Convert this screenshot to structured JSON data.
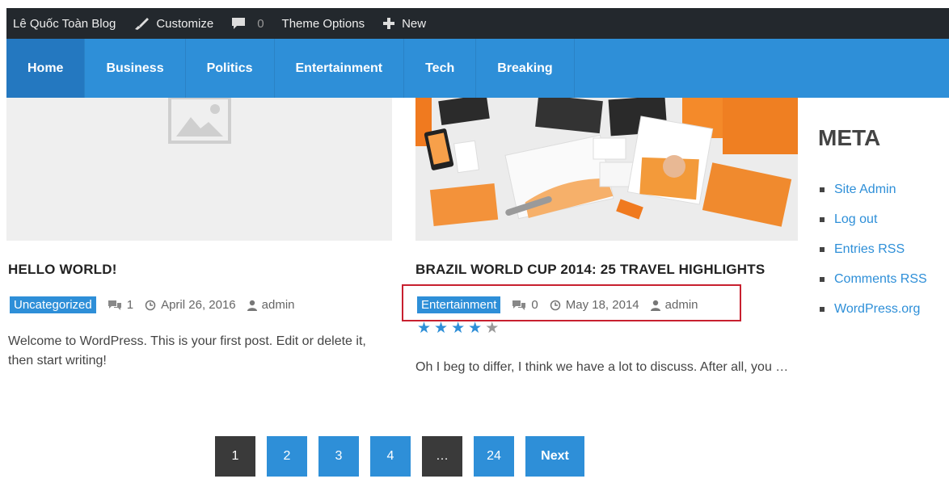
{
  "admin_bar": {
    "site_name": "Lê Quốc Toàn Blog",
    "customize": "Customize",
    "comments_count": "0",
    "theme_options": "Theme Options",
    "new": "New"
  },
  "nav": {
    "items": [
      {
        "label": "Home"
      },
      {
        "label": "Business"
      },
      {
        "label": "Politics"
      },
      {
        "label": "Entertainment"
      },
      {
        "label": "Tech"
      },
      {
        "label": "Breaking"
      }
    ]
  },
  "posts": [
    {
      "title": "HELLO WORLD!",
      "category": "Uncategorized",
      "comments": "1",
      "date": "April 26, 2016",
      "author": "admin",
      "excerpt": "Welcome to WordPress. This is your first post. Edit or delete it, then start writing!"
    },
    {
      "title": "BRAZIL WORLD CUP 2014: 25 TRAVEL HIGHLIGHTS",
      "category": "Entertainment",
      "comments": "0",
      "date": "May 18, 2014",
      "author": "admin",
      "rating_stars_filled": 4,
      "rating_stars_total": 5,
      "excerpt": "Oh I beg to differ, I think we have a lot to discuss. After all, you …"
    }
  ],
  "sidebar": {
    "heading": "META",
    "links": [
      {
        "label": "Site Admin"
      },
      {
        "label": "Log out"
      },
      {
        "label": "Entries RSS"
      },
      {
        "label": "Comments RSS"
      },
      {
        "label": "WordPress.org"
      }
    ]
  },
  "pagination": {
    "pages": [
      "1",
      "2",
      "3",
      "4",
      "…",
      "24"
    ],
    "current": "1",
    "next": "Next"
  },
  "colors": {
    "accent": "#2e8fd8",
    "admin_bar": "#23282d",
    "highlight_border": "#c8202f"
  },
  "icons": [
    "wordpress-brush-icon",
    "comment-bubble-icon",
    "plus-icon",
    "clock-icon",
    "user-icon",
    "image-placeholder-icon",
    "star-icon"
  ]
}
